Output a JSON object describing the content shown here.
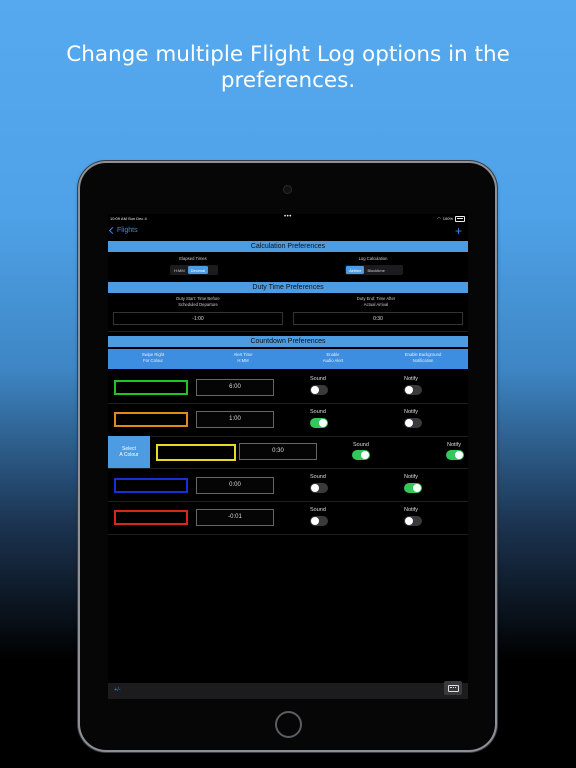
{
  "headline": {
    "line1": "Change multiple Flight Log options in the",
    "line2": "preferences."
  },
  "status_bar": {
    "time": "10:09 AM  Sun Dec 4",
    "dots": "•••",
    "battery": "100%"
  },
  "nav": {
    "back_label": "Flights",
    "add_label": "+"
  },
  "calculation": {
    "title": "Calculation Preferences",
    "elapsed_label": "Elapsed Times",
    "elapsed_options": [
      "H:MM",
      "Decimal"
    ],
    "elapsed_selected": "Decimal",
    "log_label": "Log Calculation",
    "log_options": [
      "Airtime",
      "Blocktime"
    ],
    "log_selected": "Airtime"
  },
  "duty": {
    "title": "Duty Time Preferences",
    "start_label_1": "Duty Start: Time Before",
    "start_label_2": "Scheduled Departure",
    "start_value": "-1:00",
    "end_label_1": "Duty End: Time After",
    "end_label_2": "Actual Arrival",
    "end_value": "0:30"
  },
  "countdown": {
    "title": "Countdown Preferences",
    "columns": [
      {
        "line1": "Swipe Right",
        "line2": "For Colour"
      },
      {
        "line1": "Alert Time",
        "line2": "H:MM"
      },
      {
        "line1": "Enable",
        "line2": "Audio Alert"
      },
      {
        "line1": "Enable Background",
        "line2": "Notification"
      }
    ],
    "sound_label": "Sound",
    "notify_label": "Notify",
    "select_colour_line1": "Select",
    "select_colour_line2": "A Colour",
    "rows": [
      {
        "color": "#22c422",
        "time": "6:00",
        "sound": false,
        "notify": false
      },
      {
        "color": "#e08a1e",
        "time": "1:00",
        "sound": true,
        "notify": false
      },
      {
        "color": "#e6d92a",
        "time": "0:30",
        "sound": true,
        "notify": true
      },
      {
        "color": "#1a2ed8",
        "time": "0:00",
        "sound": false,
        "notify": true
      },
      {
        "color": "#d8261a",
        "time": "-0:01",
        "sound": false,
        "notify": false
      }
    ]
  },
  "bottom_bar": {
    "plus_minus": "+/-",
    "keyboard_icon": "keyboard-icon"
  },
  "colors": {
    "accent": "#4d9ce2",
    "toggle_on": "#34c759",
    "background_top": "#56a9ee"
  }
}
